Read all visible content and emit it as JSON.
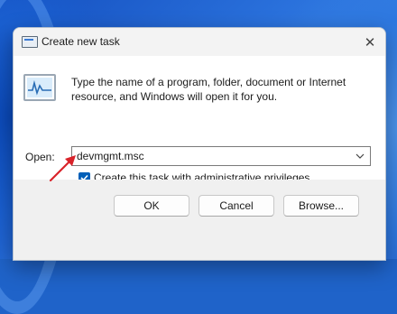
{
  "window": {
    "title": "Create new task",
    "close_glyph": "✕"
  },
  "content": {
    "description": "Type the name of a program, folder, document or Internet resource, and Windows will open it for you.",
    "open_label": "Open:",
    "open_value": "devmgmt.msc",
    "admin_checkbox_label": "Create this task with administrative privileges.",
    "admin_checked": true
  },
  "buttons": {
    "ok": "OK",
    "cancel": "Cancel",
    "browse": "Browse..."
  },
  "colors": {
    "accent": "#005fb8",
    "arrow": "#d9232a"
  }
}
